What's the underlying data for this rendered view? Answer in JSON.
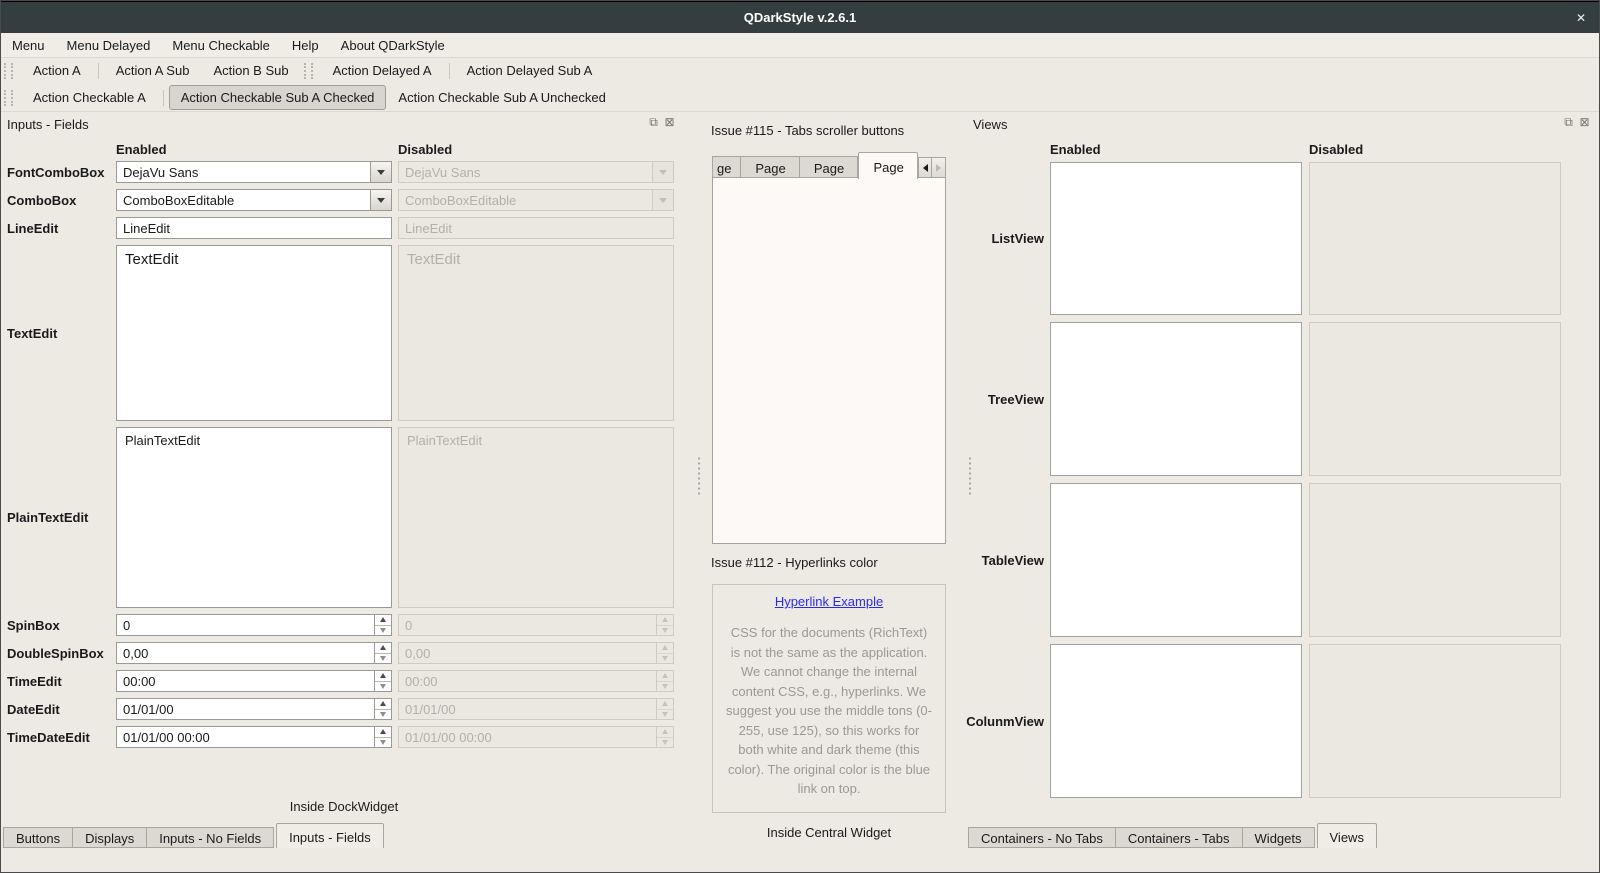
{
  "colors": {
    "titlebar_bg": "#343e40",
    "window_bg": "#edeae4",
    "link_color": "#2b2bf0",
    "note_text_color": "#9b9995",
    "field_enabled_bg": "#ffffff",
    "field_disabled_bg": "#ebe8e2"
  },
  "icons": {
    "titlebar_close": "✕",
    "dock_float": "⧉",
    "dock_close": "⊠",
    "tab_scroll_prev": "left-arrow-triangle",
    "tab_scroll_next": "right-arrow-triangle",
    "combo_dropdown": "down-arrow-triangle",
    "spin_up": "up-arrow-triangle",
    "spin_down": "down-arrow-triangle"
  },
  "titlebar": {
    "title": "QDarkStyle v.2.6.1"
  },
  "menubar": {
    "items": [
      "Menu",
      "Menu Delayed",
      "Menu Checkable",
      "Help",
      "About QDarkStyle"
    ]
  },
  "toolbar_actions": {
    "buttons": [
      "Action A",
      "Action A Sub",
      "Action B Sub",
      "Action Delayed A",
      "Action Delayed Sub A"
    ]
  },
  "toolbar_checkable": {
    "buttons": [
      "Action Checkable A",
      "Action Checkable Sub A Checked",
      "Action Checkable Sub A Unchecked"
    ],
    "checked_button": "Action Checkable Sub A Checked"
  },
  "inputs_dock": {
    "title": "Inputs - Fields",
    "columns": {
      "enabled": "Enabled",
      "disabled": "Disabled"
    },
    "rows": [
      {
        "label": "FontComboBox",
        "value": "DejaVu Sans",
        "type": "combo"
      },
      {
        "label": "ComboBox",
        "value": "ComboBoxEditable",
        "type": "combo"
      },
      {
        "label": "LineEdit",
        "value": "LineEdit",
        "type": "line"
      },
      {
        "label": "TextEdit",
        "value": "TextEdit",
        "type": "textedit"
      },
      {
        "label": "PlainTextEdit",
        "value": "PlainTextEdit",
        "type": "textedit"
      },
      {
        "label": "SpinBox",
        "value": "0",
        "type": "spin"
      },
      {
        "label": "DoubleSpinBox",
        "value": "0,00",
        "type": "spin"
      },
      {
        "label": "TimeEdit",
        "value": "00:00",
        "type": "spin"
      },
      {
        "label": "DateEdit",
        "value": "01/01/00",
        "type": "spin"
      },
      {
        "label": "TimeDateEdit",
        "value": "01/01/00 00:00",
        "type": "spin"
      }
    ],
    "footer": "Inside DockWidget",
    "tabs": [
      {
        "label": "Buttons",
        "selected": false
      },
      {
        "label": "Displays",
        "selected": false
      },
      {
        "label": "Inputs - No Fields",
        "selected": false
      },
      {
        "label": "Inputs - Fields",
        "selected": true
      }
    ]
  },
  "central": {
    "issue115": {
      "title": "Issue #115 - Tabs scroller buttons",
      "tabs": [
        "ge",
        "Page",
        "Page",
        "Page"
      ],
      "selected_tab_index": 3
    },
    "issue112": {
      "title": "Issue #112 - Hyperlinks color",
      "link_text": "Hyperlink Example",
      "body": "CSS for the documents (RichText) is not the same as the application. We cannot change the internal content CSS, e.g., hyperlinks. We suggest you use the middle tons (0-255, use 125), so this works for both white and dark theme (this color). The original color is the blue link on top."
    },
    "footer": "Inside Central Widget"
  },
  "views_dock": {
    "title": "Views",
    "columns": {
      "enabled": "Enabled",
      "disabled": "Disabled"
    },
    "rows": [
      {
        "label": "ListView"
      },
      {
        "label": "TreeView"
      },
      {
        "label": "TableView"
      },
      {
        "label": "ColunmView"
      }
    ],
    "tabs": [
      {
        "label": "Containers - No Tabs",
        "selected": false
      },
      {
        "label": "Containers - Tabs",
        "selected": false
      },
      {
        "label": "Widgets",
        "selected": false
      },
      {
        "label": "Views",
        "selected": true
      }
    ]
  }
}
